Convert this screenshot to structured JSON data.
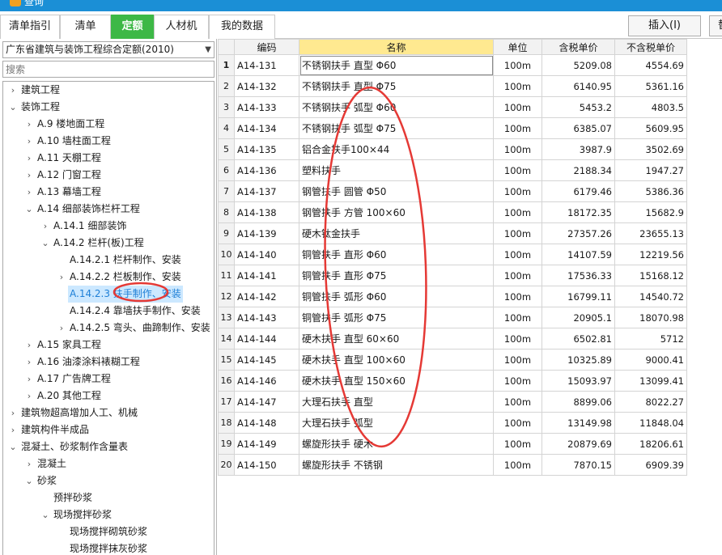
{
  "window": {
    "title": "查询"
  },
  "tabs": [
    {
      "label": "清单指引",
      "active": false
    },
    {
      "label": "清单",
      "active": false
    },
    {
      "label": "定额",
      "active": true
    },
    {
      "label": "人材机",
      "active": false
    },
    {
      "label": "我的数据",
      "active": false
    }
  ],
  "toolbar": {
    "insert_label": "插入(I)",
    "cut_label": "替"
  },
  "library": {
    "selected": "广东省建筑与装饰工程综合定额(2010)"
  },
  "search": {
    "placeholder": "搜索"
  },
  "tree": [
    {
      "label": "建筑工程",
      "expander": "collapsed"
    },
    {
      "label": "装饰工程",
      "expander": "expanded"
    },
    {
      "label": "A.9 楼地面工程",
      "expander": "collapsed"
    },
    {
      "label": "A.10 墙柱面工程",
      "expander": "collapsed"
    },
    {
      "label": "A.11 天棚工程",
      "expander": "collapsed"
    },
    {
      "label": "A.12 门窗工程",
      "expander": "collapsed"
    },
    {
      "label": "A.13 幕墙工程",
      "expander": "collapsed"
    },
    {
      "label": "A.14 细部装饰栏杆工程",
      "expander": "expanded"
    },
    {
      "label": "A.14.1 细部装饰",
      "expander": "collapsed"
    },
    {
      "label": "A.14.2 栏杆(板)工程",
      "expander": "expanded"
    },
    {
      "label": "A.14.2.1 栏杆制作、安装",
      "expander": "none"
    },
    {
      "label": "A.14.2.2 栏板制作、安装",
      "expander": "collapsed"
    },
    {
      "label": "A.14.2.3 扶手制作、安装",
      "expander": "none",
      "selected": true
    },
    {
      "label": "A.14.2.4 靠墙扶手制作、安装",
      "expander": "none"
    },
    {
      "label": "A.14.2.5 弯头、曲蹄制作、安装",
      "expander": "collapsed"
    },
    {
      "label": "A.15 家具工程",
      "expander": "collapsed"
    },
    {
      "label": "A.16 油漆涂料裱糊工程",
      "expander": "collapsed"
    },
    {
      "label": "A.17 广告牌工程",
      "expander": "collapsed"
    },
    {
      "label": "A.20 其他工程",
      "expander": "collapsed"
    },
    {
      "label": "建筑物超高增加人工、机械",
      "expander": "collapsed"
    },
    {
      "label": "建筑构件半成品",
      "expander": "collapsed"
    },
    {
      "label": "混凝土、砂浆制作含量表",
      "expander": "expanded"
    },
    {
      "label": "混凝土",
      "expander": "collapsed"
    },
    {
      "label": "砂浆",
      "expander": "expanded"
    },
    {
      "label": "预拌砂浆",
      "expander": "none"
    },
    {
      "label": "现场搅拌砂浆",
      "expander": "expanded"
    },
    {
      "label": "现场搅拌砌筑砂浆",
      "expander": "none"
    },
    {
      "label": "现场搅拌抹灰砂浆",
      "expander": "none"
    }
  ],
  "grid": {
    "columns": [
      "编码",
      "名称",
      "单位",
      "含税单价",
      "不含税单价"
    ],
    "rows": [
      {
        "no": "1",
        "code": "A14-131",
        "name": "不锈钢扶手 直型 Φ60",
        "unit": "100m",
        "tax_price": "5209.08",
        "notax_price": "4554.69"
      },
      {
        "no": "2",
        "code": "A14-132",
        "name": "不锈钢扶手 直型 Φ75",
        "unit": "100m",
        "tax_price": "6140.95",
        "notax_price": "5361.16"
      },
      {
        "no": "3",
        "code": "A14-133",
        "name": "不锈钢扶手 弧型 Φ60",
        "unit": "100m",
        "tax_price": "5453.2",
        "notax_price": "4803.5"
      },
      {
        "no": "4",
        "code": "A14-134",
        "name": "不锈钢扶手 弧型 Φ75",
        "unit": "100m",
        "tax_price": "6385.07",
        "notax_price": "5609.95"
      },
      {
        "no": "5",
        "code": "A14-135",
        "name": "铝合金扶手100×44",
        "unit": "100m",
        "tax_price": "3987.9",
        "notax_price": "3502.69"
      },
      {
        "no": "6",
        "code": "A14-136",
        "name": "塑料扶手",
        "unit": "100m",
        "tax_price": "2188.34",
        "notax_price": "1947.27"
      },
      {
        "no": "7",
        "code": "A14-137",
        "name": "钢管扶手 圆管 Φ50",
        "unit": "100m",
        "tax_price": "6179.46",
        "notax_price": "5386.36"
      },
      {
        "no": "8",
        "code": "A14-138",
        "name": "钢管扶手 方管 100×60",
        "unit": "100m",
        "tax_price": "18172.35",
        "notax_price": "15682.9"
      },
      {
        "no": "9",
        "code": "A14-139",
        "name": "硬木钛金扶手",
        "unit": "100m",
        "tax_price": "27357.26",
        "notax_price": "23655.13"
      },
      {
        "no": "10",
        "code": "A14-140",
        "name": "铜管扶手 直形 Φ60",
        "unit": "100m",
        "tax_price": "14107.59",
        "notax_price": "12219.56"
      },
      {
        "no": "11",
        "code": "A14-141",
        "name": "铜管扶手 直形 Φ75",
        "unit": "100m",
        "tax_price": "17536.33",
        "notax_price": "15168.12"
      },
      {
        "no": "12",
        "code": "A14-142",
        "name": "铜管扶手 弧形 Φ60",
        "unit": "100m",
        "tax_price": "16799.11",
        "notax_price": "14540.72"
      },
      {
        "no": "13",
        "code": "A14-143",
        "name": "铜管扶手 弧形 Φ75",
        "unit": "100m",
        "tax_price": "20905.1",
        "notax_price": "18070.98"
      },
      {
        "no": "14",
        "code": "A14-144",
        "name": "硬木扶手 直型 60×60",
        "unit": "100m",
        "tax_price": "6502.81",
        "notax_price": "5712"
      },
      {
        "no": "15",
        "code": "A14-145",
        "name": "硬木扶手 直型 100×60",
        "unit": "100m",
        "tax_price": "10325.89",
        "notax_price": "9000.41"
      },
      {
        "no": "16",
        "code": "A14-146",
        "name": "硬木扶手 直型 150×60",
        "unit": "100m",
        "tax_price": "15093.97",
        "notax_price": "13099.41"
      },
      {
        "no": "17",
        "code": "A14-147",
        "name": "大理石扶手 直型",
        "unit": "100m",
        "tax_price": "8899.06",
        "notax_price": "8022.27"
      },
      {
        "no": "18",
        "code": "A14-148",
        "name": "大理石扶手 弧型",
        "unit": "100m",
        "tax_price": "13149.98",
        "notax_price": "11848.04"
      },
      {
        "no": "19",
        "code": "A14-149",
        "name": "螺旋形扶手 硬木",
        "unit": "100m",
        "tax_price": "20879.69",
        "notax_price": "18206.61"
      },
      {
        "no": "20",
        "code": "A14-150",
        "name": "螺旋形扶手 不锈钢",
        "unit": "100m",
        "tax_price": "7870.15",
        "notax_price": "6909.39"
      }
    ]
  },
  "colors": {
    "accent_tab": "#3db846",
    "titlebar": "#1b8fd6",
    "name_header": "#ffe990",
    "annotation": "#e53935",
    "selection": "#cce8ff"
  }
}
